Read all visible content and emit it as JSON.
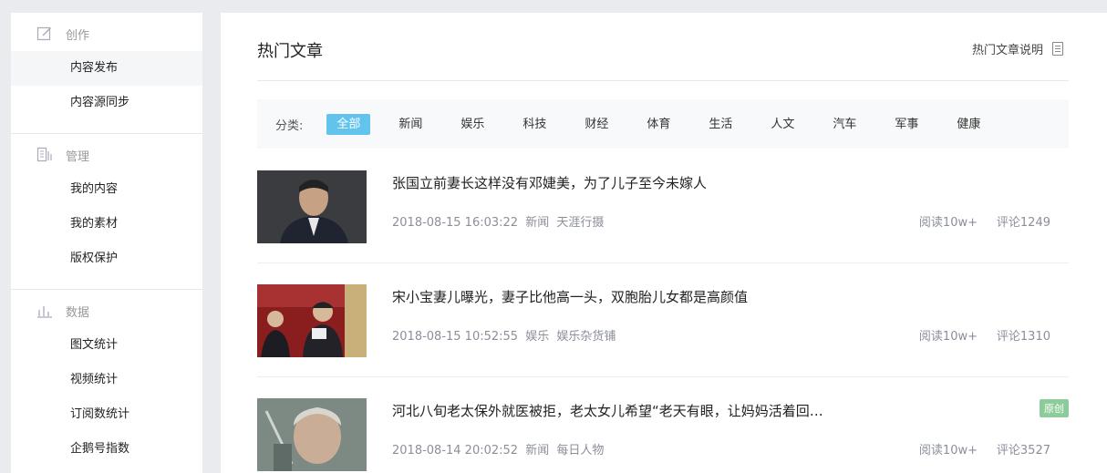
{
  "sidebar": {
    "sections": [
      {
        "title": "创作",
        "icon": "edit-icon",
        "items": [
          "内容发布",
          "内容源同步"
        ]
      },
      {
        "title": "管理",
        "icon": "manage-icon",
        "items": [
          "我的内容",
          "我的素材",
          "版权保护"
        ]
      },
      {
        "title": "数据",
        "icon": "bar-chart-icon",
        "items": [
          "图文统计",
          "视频统计",
          "订阅数统计",
          "企鹅号指数"
        ]
      }
    ],
    "active_item": "内容发布"
  },
  "main": {
    "title": "热门文章",
    "help_link": "热门文章说明",
    "filter": {
      "label": "分类:",
      "tabs": [
        "全部",
        "新闻",
        "娱乐",
        "科技",
        "财经",
        "体育",
        "生活",
        "人文",
        "汽车",
        "军事",
        "健康"
      ],
      "active": "全部"
    },
    "articles": [
      {
        "title": "张国立前妻长这样没有邓婕美，为了儿子至今未嫁人",
        "time": "2018-08-15 16:03:22",
        "category": "新闻",
        "source": "天涯行摄",
        "reads": "阅读10w+",
        "comments": "评论1249",
        "badge": ""
      },
      {
        "title": "宋小宝妻儿曝光，妻子比他高一头，双胞胎儿女都是高颜值",
        "time": "2018-08-15 10:52:55",
        "category": "娱乐",
        "source": "娱乐杂货铺",
        "reads": "阅读10w+",
        "comments": "评论1310",
        "badge": ""
      },
      {
        "title": "河北八旬老太保外就医被拒，老太女儿希望“老天有眼，让妈妈活着回…",
        "time": "2018-08-14 20:02:52",
        "category": "新闻",
        "source": "每日人物",
        "reads": "阅读10w+",
        "comments": "评论3527",
        "badge": "原创"
      }
    ]
  },
  "colors": {
    "accent": "#62c4ec",
    "badge": "#8ccc9a",
    "meta_text": "#8a8f99"
  }
}
